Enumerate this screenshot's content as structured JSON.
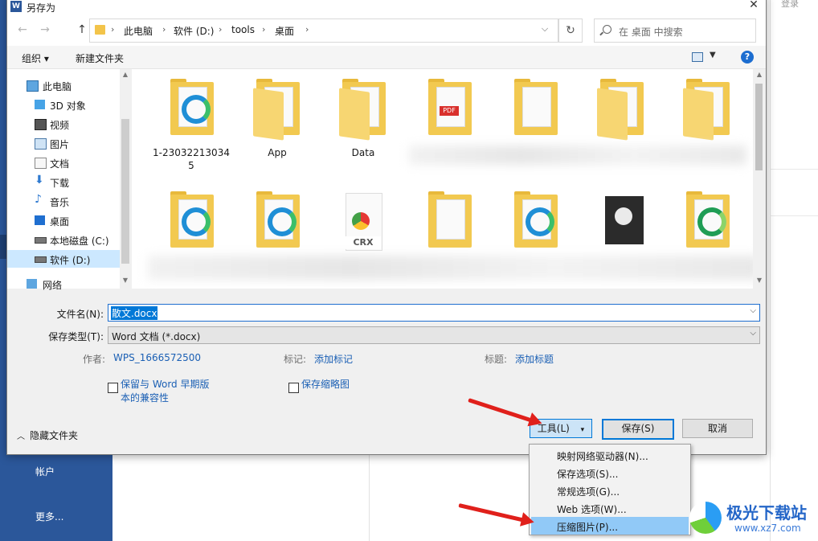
{
  "background_app": {
    "sidebar_items": [
      "帐户",
      "更多..."
    ],
    "signin_label": "登录",
    "accent": "#2b579a"
  },
  "dialog": {
    "title": "另存为",
    "app_icon": "word-icon",
    "close_label": "✕",
    "nav": {
      "back": "←",
      "forward": "→",
      "up": "↑"
    },
    "breadcrumb": [
      "此电脑",
      "软件 (D:)",
      "tools",
      "桌面"
    ],
    "refresh_label": "↻",
    "search_placeholder": "在 桌面 中搜索",
    "toolbar": {
      "organize": "组织 ▾",
      "new_folder": "新建文件夹",
      "help": "?"
    },
    "nav_items": [
      {
        "label": "此电脑",
        "icon": "computer-icon"
      },
      {
        "label": "3D 对象",
        "icon": "cube-icon"
      },
      {
        "label": "视频",
        "icon": "video-icon"
      },
      {
        "label": "图片",
        "icon": "picture-icon"
      },
      {
        "label": "文档",
        "icon": "document-icon"
      },
      {
        "label": "下载",
        "icon": "download-icon"
      },
      {
        "label": "音乐",
        "icon": "music-icon"
      },
      {
        "label": "桌面",
        "icon": "desktop-icon"
      },
      {
        "label": "本地磁盘 (C:)",
        "icon": "drive-icon"
      },
      {
        "label": "软件 (D:)",
        "icon": "drive-icon",
        "selected": true
      },
      {
        "label": "网络",
        "icon": "network-icon"
      }
    ],
    "files": [
      {
        "label": "1-23032213034\n5",
        "kind": "edge-folder"
      },
      {
        "label": "App",
        "kind": "folder"
      },
      {
        "label": "Data",
        "kind": "folder"
      }
    ],
    "filename_label": "文件名(N):",
    "filename_value": "散文.docx",
    "filetype_label": "保存类型(T):",
    "filetype_value": "Word 文档 (*.docx)",
    "meta": {
      "author_label": "作者:",
      "author_value": "WPS_1666572500",
      "tags_label": "标记:",
      "tags_value": "添加标记",
      "title_label": "标题:",
      "title_value": "添加标题"
    },
    "checkboxes": [
      {
        "label": "保留与 Word 早期版\n本的兼容性",
        "checked": false
      },
      {
        "label": "保存缩略图",
        "checked": false
      }
    ],
    "hide_folders": "隐藏文件夹",
    "buttons": {
      "tools": "工具(L)",
      "tools_arrow": "▾",
      "save": "保存(S)",
      "cancel": "取消"
    },
    "tools_menu": [
      {
        "label": "映射网络驱动器(N)...",
        "highlighted": false
      },
      {
        "label": "保存选项(S)...",
        "highlighted": false
      },
      {
        "label": "常规选项(G)...",
        "highlighted": false
      },
      {
        "label": "Web 选项(W)...",
        "highlighted": false
      },
      {
        "label": "压缩图片(P)...",
        "highlighted": true
      }
    ]
  },
  "watermark": {
    "title": "极光下载站",
    "url": "www.xz7.com"
  },
  "colors": {
    "selection": "#0078d7",
    "menu_highlight": "#91c9f7",
    "arrow": "#e0201b",
    "link": "#1a5fb4"
  }
}
